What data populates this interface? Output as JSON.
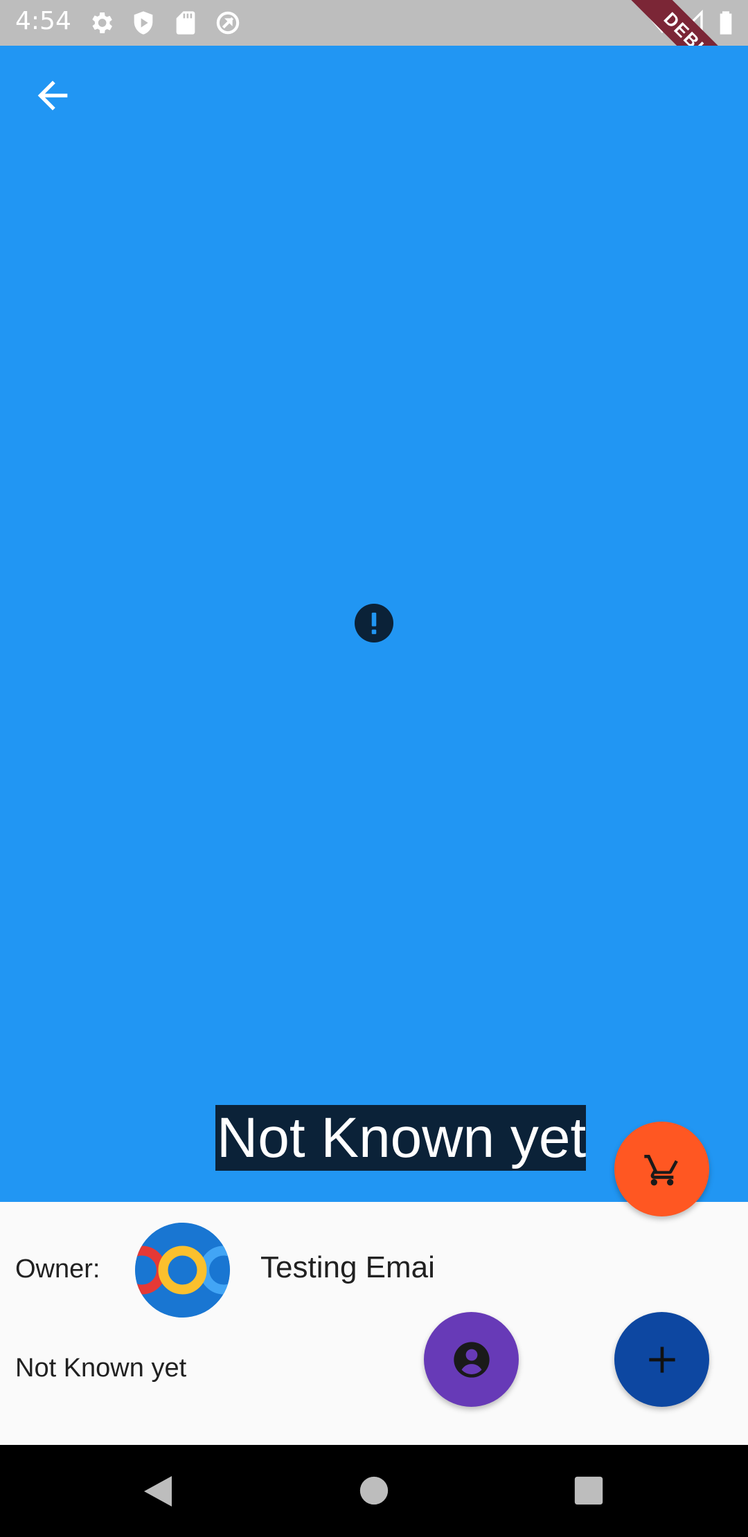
{
  "status_bar": {
    "time": "4:54",
    "icons": [
      "settings-icon",
      "shield-icon",
      "sd-card-icon",
      "sync-icon",
      "wifi-icon",
      "signal-icon",
      "battery-icon"
    ],
    "debug_banner": "DEBUG"
  },
  "header": {
    "back_icon": "arrow-back-icon",
    "title": "Not Known yet",
    "background_color": "#2196f3",
    "placeholder_icon": "error-icon"
  },
  "fabs": {
    "cart": {
      "icon": "cart-icon",
      "color": "#ff5722"
    },
    "profile": {
      "icon": "account-circle-icon",
      "color": "#673ab7"
    },
    "add": {
      "icon": "add-icon",
      "color": "#0d47a1"
    }
  },
  "details": {
    "owner_label": "Owner:",
    "owner_email": "Testing Emai",
    "status": "Not Known yet"
  },
  "nav_bar": {
    "icons": [
      "back-triangle-icon",
      "home-circle-icon",
      "recents-square-icon"
    ]
  }
}
